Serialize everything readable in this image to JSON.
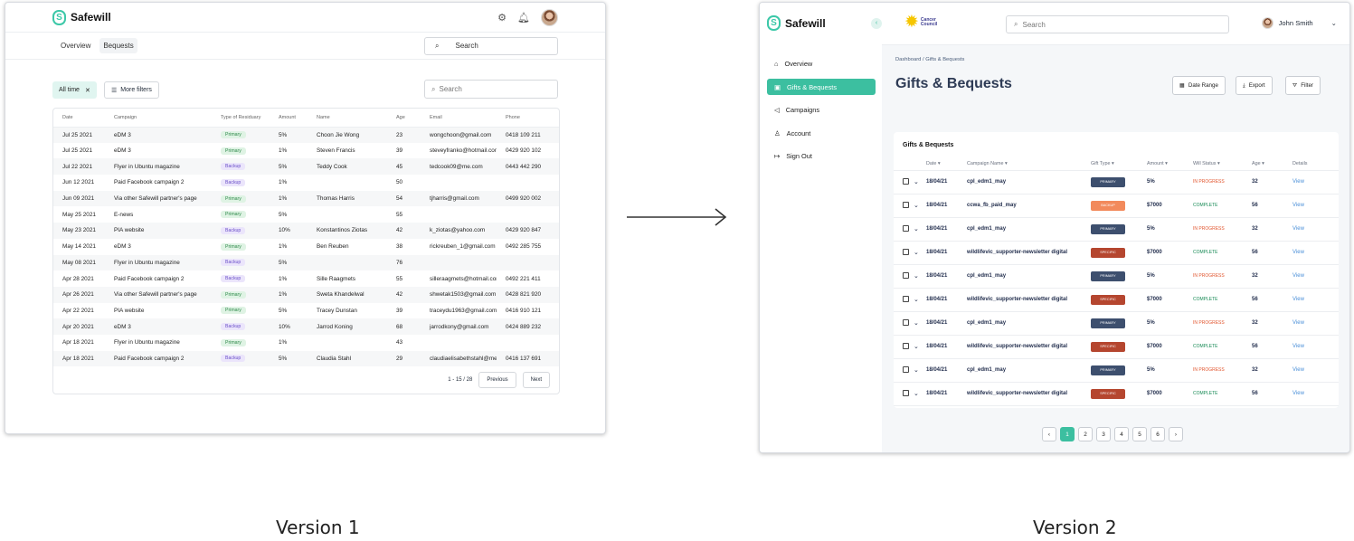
{
  "v1": {
    "brand": "Safewill",
    "tabs": [
      "Overview",
      "Bequests"
    ],
    "search_placeholder": "Search",
    "filter_chip": "All time",
    "more_filters": "More filters",
    "table_search_placeholder": "Search",
    "columns": [
      "Date",
      "Campaign",
      "Type of Residuary",
      "Amount",
      "Name",
      "Age",
      "Email",
      "Phone"
    ],
    "rows": [
      [
        "Jul 25 2021",
        "eDM 3",
        "Primary",
        "5%",
        "Choon Jie Wong",
        "23",
        "wongchoon@gmail.com",
        "0418 109 211"
      ],
      [
        "Jul 25 2021",
        "eDM 3",
        "Primary",
        "1%",
        "Steven Francis",
        "39",
        "steveyfranko@hotmail.com",
        "0429 920 102"
      ],
      [
        "Jul 22 2021",
        "Flyer in Ubuntu magazine",
        "Backup",
        "5%",
        "Teddy Cook",
        "45",
        "tedcook09@me.com",
        "0443 442 290"
      ],
      [
        "Jun 12 2021",
        "Paid Facebook campaign 2",
        "Backup",
        "1%",
        "",
        "50",
        "",
        ""
      ],
      [
        "Jun 09 2021",
        "Via other Safewill partner's page",
        "Primary",
        "1%",
        "Thomas Harris",
        "54",
        "tjharris@gmail.com",
        "0499 920 002"
      ],
      [
        "May 25 2021",
        "E-news",
        "Primary",
        "5%",
        "",
        "55",
        "",
        ""
      ],
      [
        "May 23 2021",
        "PIA website",
        "Backup",
        "10%",
        "Konstantinos Ziotas",
        "42",
        "k_ziotas@yahoo.com",
        "0429 920 847"
      ],
      [
        "May 14 2021",
        "eDM 3",
        "Primary",
        "1%",
        "Ben Reuben",
        "38",
        "rickreuben_1@gmail.com",
        "0492 285 755"
      ],
      [
        "May 08 2021",
        "Flyer in Ubuntu magazine",
        "Backup",
        "5%",
        "",
        "76",
        "",
        ""
      ],
      [
        "Apr 28 2021",
        "Paid Facebook campaign 2",
        "Backup",
        "1%",
        "Sille Raagmets",
        "55",
        "silleraagmets@hotmail.com",
        "0492 221 411"
      ],
      [
        "Apr 26 2021",
        "Via other Safewill partner's page",
        "Primary",
        "1%",
        "Sweta Khandelwal",
        "42",
        "shwetak1503@gmail.com",
        "0428 821 920"
      ],
      [
        "Apr 22 2021",
        "PIA website",
        "Primary",
        "5%",
        "Tracey Dunstan",
        "39",
        "traceydu1963@gmail.com",
        "0416 910 121"
      ],
      [
        "Apr 20 2021",
        "eDM 3",
        "Backup",
        "10%",
        "Jarrod Koning",
        "68",
        "jarrodkony@gmail.com",
        "0424 889 232"
      ],
      [
        "Apr 18 2021",
        "Flyer in Ubuntu magazine",
        "Primary",
        "1%",
        "",
        "43",
        "",
        ""
      ],
      [
        "Apr 18 2021",
        "Paid Facebook campaign 2",
        "Backup",
        "5%",
        "Claudia Stahl",
        "29",
        "claudiaelisabethstahl@me.com",
        "0416 137 691"
      ]
    ],
    "pagination": {
      "range": "1 - 15 / 28",
      "previous": "Previous",
      "next": "Next"
    },
    "caption": "Version 1"
  },
  "v2": {
    "brand": "Safewill",
    "partner": "Cancer Council",
    "search_placeholder": "Search",
    "user_name": "John Smith",
    "nav": [
      "Overview",
      "Gifts & Bequests",
      "Campaigns",
      "Account",
      "Sign Out"
    ],
    "breadcrumb": "Dashboard / Gifts & Bequests",
    "page_title": "Gifts & Bequests",
    "buttons": {
      "date_range": "Date Range",
      "export": "Export",
      "filter": "Filter"
    },
    "card_title": "Gifts & Bequests",
    "columns": [
      "Date",
      "Campaign Name",
      "Gift Type",
      "Amount",
      "Will Status",
      "Age",
      "Details"
    ],
    "rows": [
      [
        "18/04/21",
        "cpl_edm1_may",
        "PRIMARY",
        "5%",
        "IN PROGRESS",
        "32",
        "View"
      ],
      [
        "18/04/21",
        "ccwa_fb_paid_may",
        "BACKUP",
        "$7000",
        "COMPLETE",
        "56",
        "View"
      ],
      [
        "18/04/21",
        "cpl_edm1_may",
        "PRIMARY",
        "5%",
        "IN PROGRESS",
        "32",
        "View"
      ],
      [
        "18/04/21",
        "wildlifevic_supporter-newsletter digital",
        "SPECIFIC",
        "$7000",
        "COMPLETE",
        "56",
        "View"
      ],
      [
        "18/04/21",
        "cpl_edm1_may",
        "PRIMARY",
        "5%",
        "IN PROGRESS",
        "32",
        "View"
      ],
      [
        "18/04/21",
        "wildlifevic_supporter-newsletter digital",
        "SPECIFIC",
        "$7000",
        "COMPLETE",
        "56",
        "View"
      ],
      [
        "18/04/21",
        "cpl_edm1_may",
        "PRIMARY",
        "5%",
        "IN PROGRESS",
        "32",
        "View"
      ],
      [
        "18/04/21",
        "wildlifevic_supporter-newsletter digital",
        "SPECIFIC",
        "$7000",
        "COMPLETE",
        "56",
        "View"
      ],
      [
        "18/04/21",
        "cpl_edm1_may",
        "PRIMARY",
        "5%",
        "IN PROGRESS",
        "32",
        "View"
      ],
      [
        "18/04/21",
        "wildlifevic_supporter-newsletter digital",
        "SPECIFIC",
        "$7000",
        "COMPLETE",
        "56",
        "View"
      ]
    ],
    "pages": [
      "‹",
      "1",
      "2",
      "3",
      "4",
      "5",
      "6",
      "›"
    ],
    "caption": "Version 2"
  },
  "colors": {
    "accent": "#3cbfa0",
    "primary_tag": "#3d4f6e",
    "backup_tag": "#f28a5c",
    "specific_tag": "#b5462f",
    "in_progress": "#e2562f",
    "complete": "#178a55"
  }
}
